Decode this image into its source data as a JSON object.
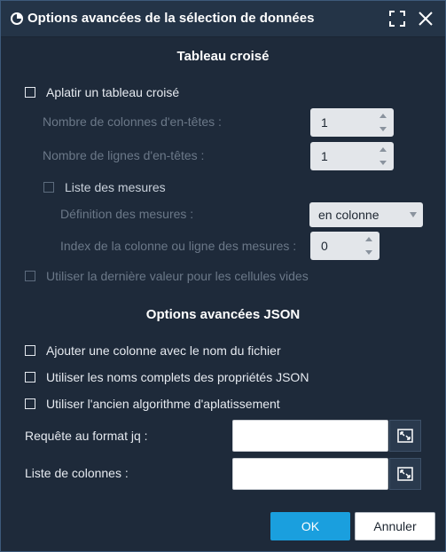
{
  "dialog": {
    "title": "Options avancées de la sélection de données",
    "icons": {
      "logo": "app-logo-icon",
      "fullscreen": "fullscreen-icon",
      "close": "close-icon"
    }
  },
  "pivot": {
    "section_title": "Tableau croisé",
    "flatten_label": "Aplatir un tableau croisé",
    "header_cols_label": "Nombre de colonnes d'en-têtes :",
    "header_cols_value": "1",
    "header_rows_label": "Nombre de lignes d'en-têtes :",
    "header_rows_value": "1",
    "measures_list_label": "Liste des mesures",
    "measures_def_label": "Définition des mesures :",
    "measures_def_value": "en colonne",
    "measures_index_label": "Index de la colonne ou ligne des mesures :",
    "measures_index_value": "0",
    "last_value_label": "Utiliser la dernière valeur pour les cellules vides"
  },
  "json": {
    "section_title": "Options avancées JSON",
    "add_filename_label": "Ajouter une colonne avec le nom du fichier",
    "full_names_label": "Utiliser les noms complets des propriétés JSON",
    "old_algo_label": "Utiliser l'ancien algorithme d'aplatissement",
    "jq_label": "Requête au format jq :",
    "jq_value": "",
    "columns_label": "Liste de colonnes :",
    "columns_value": ""
  },
  "footer": {
    "ok_label": "OK",
    "cancel_label": "Annuler"
  },
  "colors": {
    "background": "#1e2a3a",
    "accent": "#1a9fde",
    "disabled_text": "#6b7888"
  }
}
